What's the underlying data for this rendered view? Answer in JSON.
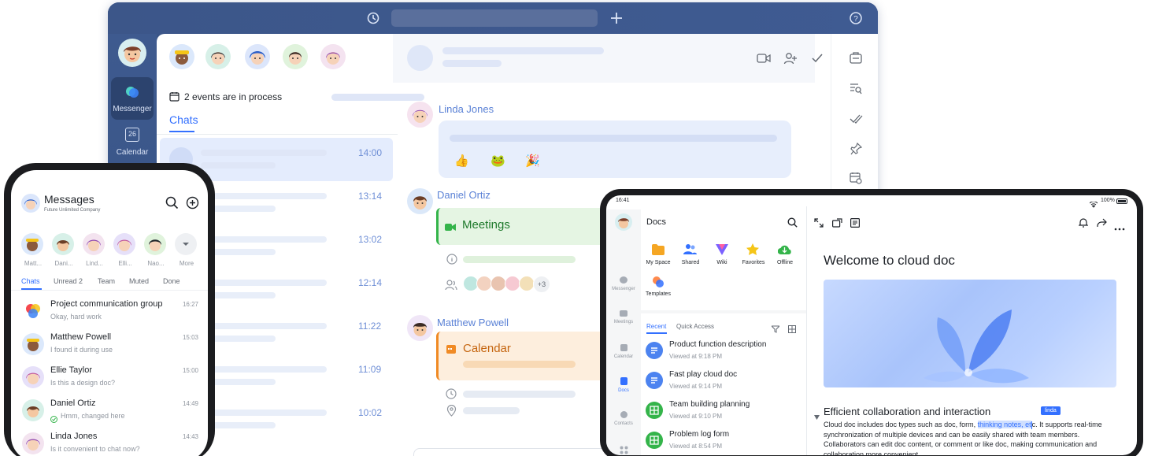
{
  "desktop": {
    "rail": {
      "messenger_label": "Messenger",
      "calendar_label": "Calendar",
      "calendar_day": "26"
    },
    "events_text": "2 events are in process",
    "chats_tab": "Chats",
    "times": [
      "14:00",
      "13:14",
      "13:02",
      "12:14",
      "11:22",
      "11:09",
      "10:02"
    ],
    "messages": [
      {
        "sender": "Linda Jones",
        "reactions": [
          "👍",
          "🐸",
          "🎉"
        ]
      },
      {
        "sender": "Daniel Ortiz",
        "card_title": "Meetings",
        "extra_count": "+3"
      },
      {
        "sender": "Matthew Powell",
        "card_title": "Calendar"
      }
    ]
  },
  "phone": {
    "status_time": "",
    "title": "Messages",
    "subtitle": "Future Unlimited Company",
    "stories": [
      {
        "label": "Matt..."
      },
      {
        "label": "Dani..."
      },
      {
        "label": "Lind..."
      },
      {
        "label": "Elli..."
      },
      {
        "label": "Nao..."
      },
      {
        "label": "More"
      }
    ],
    "tabs": [
      "Chats",
      "Unread 2",
      "Team",
      "Muted",
      "Done"
    ],
    "chats": [
      {
        "name": "Project communication group",
        "message": "Okay, hard work",
        "time": "16:27"
      },
      {
        "name": "Matthew Powell",
        "message": "I found it during use",
        "time": "15:03"
      },
      {
        "name": "Ellie Taylor",
        "message": "Is this a design doc?",
        "time": "15:00"
      },
      {
        "name": "Daniel Ortiz",
        "message": "Hmm, changed here",
        "time": "14:49"
      },
      {
        "name": "Linda Jones",
        "message": "Is it convenient to chat now?",
        "time": "14:43"
      }
    ]
  },
  "tablet": {
    "status_time": "16:41",
    "status_battery": "100%",
    "title": "Docs",
    "categories": [
      "My Space",
      "Shared",
      "Wiki",
      "Favorites",
      "Offline",
      "Templates"
    ],
    "nav": [
      "Messenger",
      "Meetings",
      "Calendar",
      "Docs",
      "Contacts"
    ],
    "list_tabs": [
      "Recent",
      "Quick Access"
    ],
    "docs": [
      {
        "name": "Product function description",
        "sub": "Viewed at 9:18 PM",
        "color": "#4c83f0"
      },
      {
        "name": "Fast play cloud doc",
        "sub": "Viewed at 9:14 PM",
        "color": "#4c83f0"
      },
      {
        "name": "Team building planning",
        "sub": "Viewed at 9:10 PM",
        "color": "#34b44a"
      },
      {
        "name": "Problem log form",
        "sub": "Viewed at 8:54 PM",
        "color": "#34b44a"
      }
    ],
    "doc_title": "Welcome to cloud doc",
    "section_title": "Efficient collaboration and interaction",
    "cursor_label": "linda",
    "body_before": "Cloud doc includes doc types such as doc, form, ",
    "body_highlight": "thinking notes, et",
    "body_after": "c. It supports real-time synchronization of multiple devices and can be easily shared with team members. Collaborators can edit doc content, or comment or like doc, making communication and collaboration more convenient."
  },
  "colors": {
    "brand_blue": "#3370ff",
    "desktop_frame": "#3c5689",
    "meetings_green": "#34b44a",
    "calendar_orange": "#f08a24"
  }
}
